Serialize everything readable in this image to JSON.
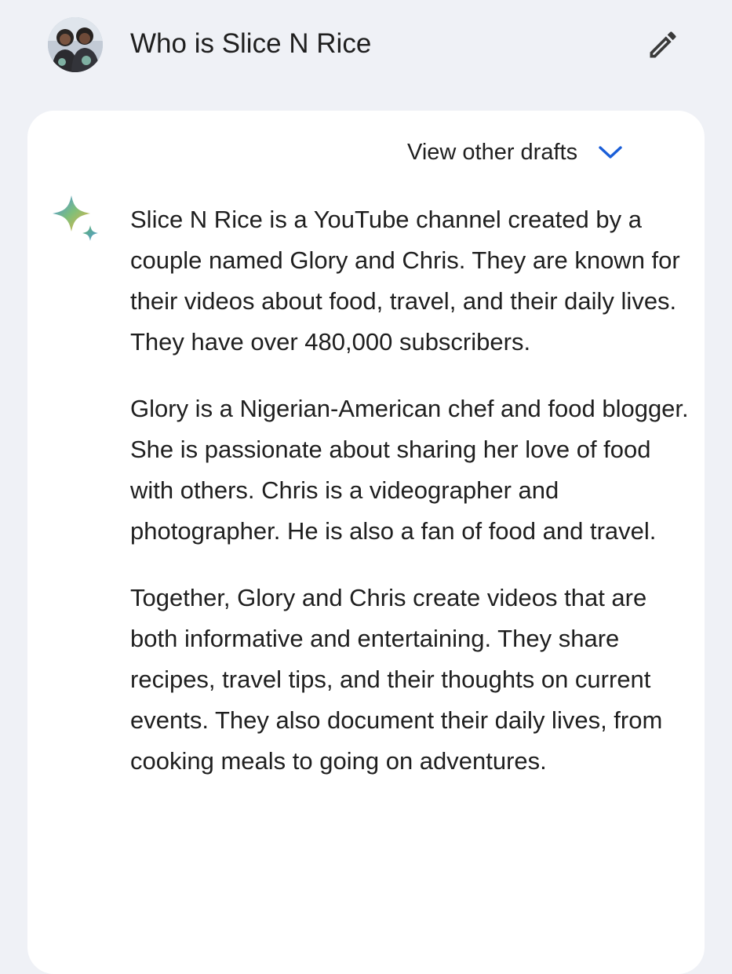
{
  "prompt": {
    "text": "Who is Slice N Rice",
    "avatar_icon": "user-avatar-photo",
    "edit_icon": "pencil-icon"
  },
  "response": {
    "drafts_label": "View other drafts",
    "drafts_icon": "chevron-down-icon",
    "model_icon": "sparkle-icon",
    "paragraphs": [
      "Slice N Rice is a YouTube channel created by a couple named Glory and Chris. They are known for their videos about food, travel, and their daily lives. They have over 480,000 subscribers.",
      "Glory is a Nigerian-American chef and food blogger. She is passionate about sharing her love of food with others. Chris is a videographer and photographer. He is also a fan of food and travel.",
      "Together, Glory and Chris create videos that are both informative and entertaining. They share recipes, travel tips, and their thoughts on current events. They also document their daily lives, from cooking meals to going on adventures."
    ]
  },
  "colors": {
    "page_background": "#eff1f6",
    "card_background": "#ffffff",
    "text": "#1f1f1f",
    "accent_chevron": "#1a5ed8"
  }
}
